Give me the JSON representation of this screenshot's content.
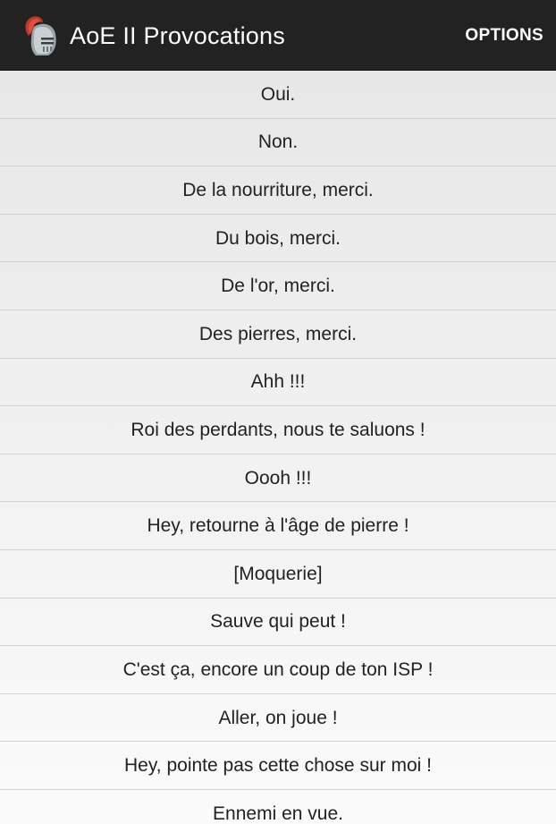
{
  "action_bar": {
    "title": "AoE II Provocations",
    "options_label": "OPTIONS",
    "icon": "knight-helmet-icon"
  },
  "taunts": [
    "Oui.",
    "Non.",
    "De la nourriture, merci.",
    "Du bois, merci.",
    "De l'or, merci.",
    "Des pierres, merci.",
    "Ahh !!!",
    "Roi des perdants, nous te saluons !",
    "Oooh !!!",
    "Hey, retourne à l'âge de pierre !",
    "[Moquerie]",
    "Sauve qui peut !",
    "C'est ça, encore un coup de ton ISP !",
    "Aller, on joue !",
    "Hey, pointe pas cette chose sur moi !",
    "Ennemi en vue."
  ],
  "colors": {
    "action_bar": "#222222",
    "text": "#222222",
    "divider": "#d4d4d4"
  }
}
